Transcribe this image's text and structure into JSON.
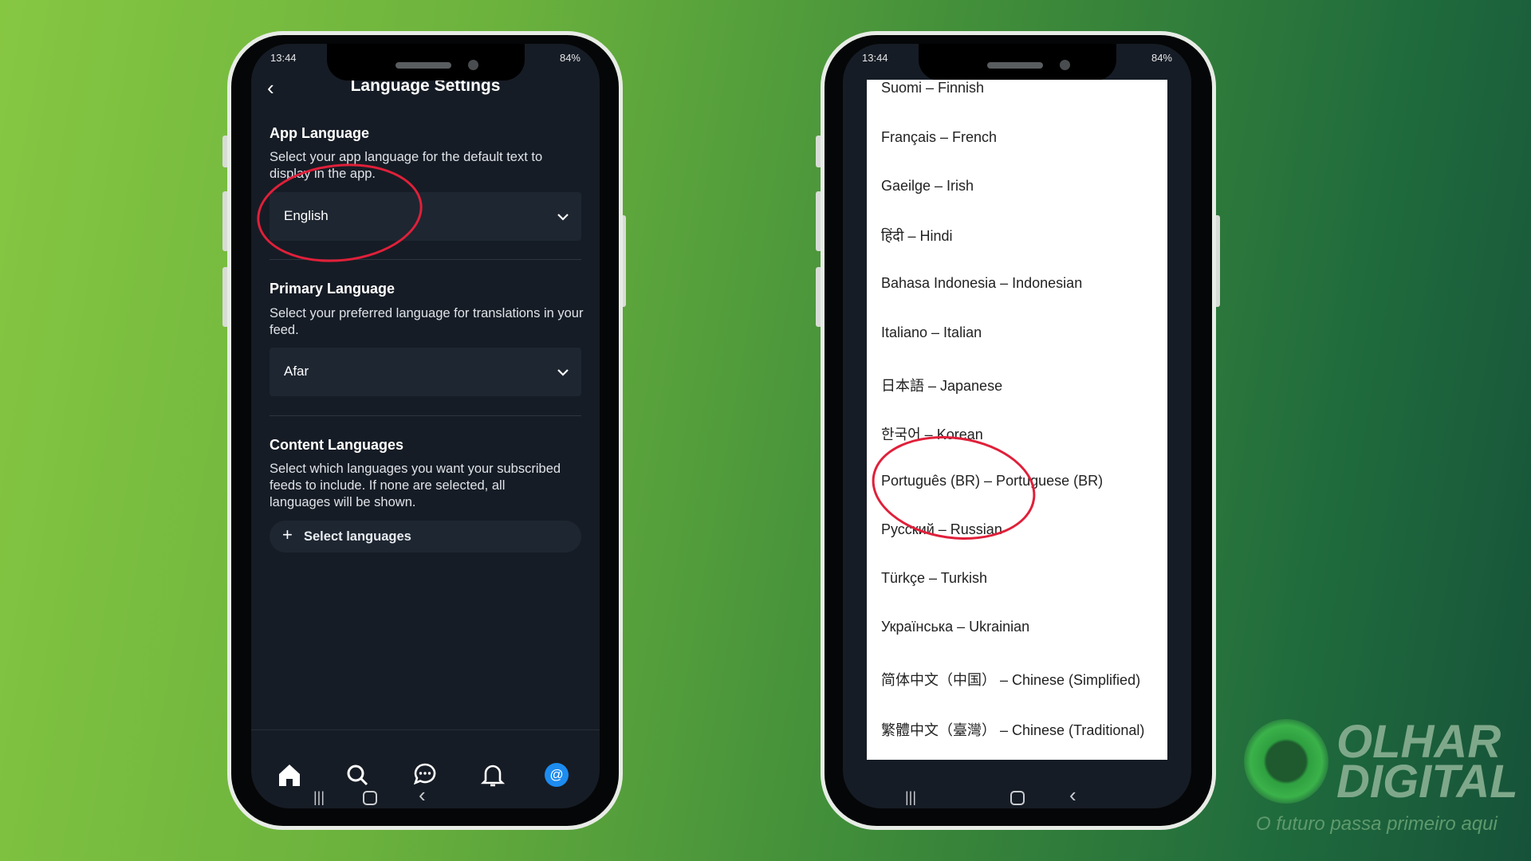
{
  "left_phone": {
    "status_time": "13:44",
    "status_right": "84%",
    "title": "Language Settings",
    "app_language": {
      "heading": "App Language",
      "description": "Select your app language for the default text to display in the app.",
      "selected": "English"
    },
    "primary_language": {
      "heading": "Primary Language",
      "description": "Select your preferred language for translations in your feed.",
      "selected": "Afar"
    },
    "content_languages": {
      "heading": "Content Languages",
      "description": "Select which languages you want your subscribed feeds to include. If none are selected, all languages will be shown.",
      "button": "Select languages"
    },
    "bottom_nav": [
      "home-icon",
      "search-icon",
      "chat-icon",
      "bell-icon",
      "profile-at-icon"
    ],
    "accent": "#1d8cf0"
  },
  "right_phone": {
    "status_time": "13:44",
    "status_right": "84%",
    "languages": [
      "Suomi – Finnish",
      "Français – French",
      "Gaeilge – Irish",
      "हिंदी – Hindi",
      "Bahasa Indonesia – Indonesian",
      "Italiano – Italian",
      "日本語 – Japanese",
      "한국어 – Korean",
      "Português (BR) – Portuguese (BR)",
      "Русский – Russian",
      "Türkçe – Turkish",
      "Українська – Ukrainian",
      "简体中文（中国） – Chinese (Simplified)",
      "繁體中文（臺灣） – Chinese (Traditional)"
    ],
    "highlighted": "Português (BR) – Portuguese (BR)"
  },
  "logo": {
    "line1": "OLHAR",
    "line2": "DIGITAL",
    "tagline": "O futuro passa primeiro aqui"
  },
  "annotation_color": "#e0203a"
}
